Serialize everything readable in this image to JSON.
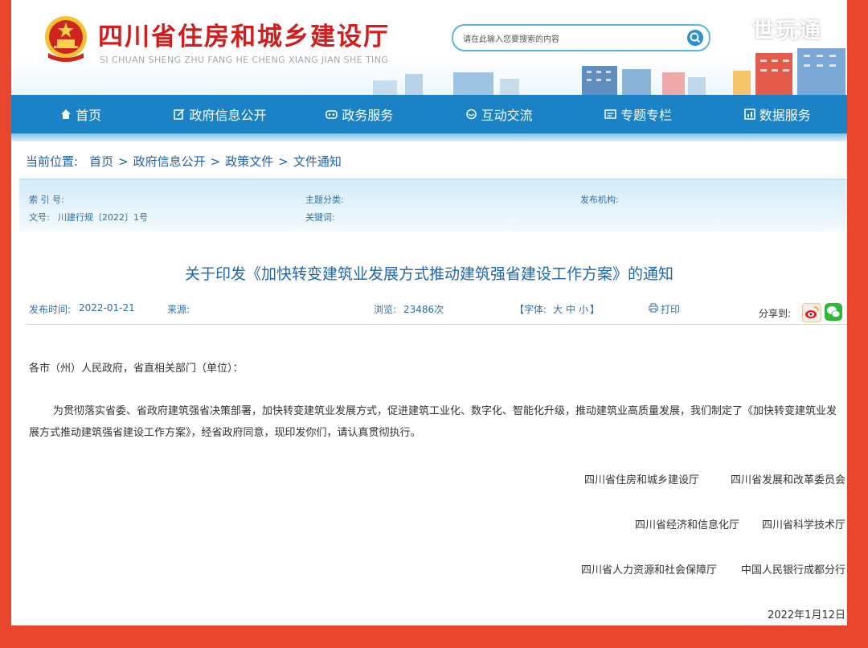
{
  "header": {
    "title": "四川省住房和城乡建设厅",
    "subtitle": "SI CHUAN SHENG ZHU FANG HE CHENG XIANG JIAN SHE TING",
    "search_placeholder": "请在此输入您要搜索的内容",
    "watermark": "世玩通"
  },
  "nav": {
    "items": [
      {
        "label": "首页",
        "icon": "home-icon"
      },
      {
        "label": "政府信息公开",
        "icon": "edit-icon"
      },
      {
        "label": "政务服务",
        "icon": "service-icon"
      },
      {
        "label": "互动交流",
        "icon": "chat-icon"
      },
      {
        "label": "专题专栏",
        "icon": "topic-icon"
      },
      {
        "label": "数据服务",
        "icon": "data-icon"
      }
    ]
  },
  "breadcrumb": {
    "prefix": "当前位置:",
    "items": [
      "首页",
      "政府信息公开",
      "政策文件",
      "文件通知"
    ],
    "sep": ">"
  },
  "meta": {
    "index_label": "索 引 号:",
    "topic_label": "主题分类:",
    "issuer_label": "发布机构:",
    "docno_label": "文号:",
    "docno_value": "川建行规〔2022〕1号",
    "keywords_label": "关键词:"
  },
  "document": {
    "title": "关于印发《加快转变建筑业发展方式推动建筑强省建设工作方案》的通知",
    "publish_label": "发布时间:",
    "publish_date": "2022-01-21",
    "source_label": "来源:",
    "views_label": "浏览:",
    "views_value": "23486次",
    "font_label": "【字体:",
    "font_large": "大",
    "font_medium": "中",
    "font_small": "小",
    "font_close": "】",
    "print_label": "打印",
    "share_label": "分享到:",
    "salutation": "各市（州）人民政府，省直相关部门（单位）：",
    "paragraph": "为贯彻落实省委、省政府建筑强省决策部署，加快转变建筑业发展方式，促进建筑工业化、数字化、智能化升级，推动建筑业高质量发展，我们制定了《加快转变建筑业发展方式推动建筑强省建设工作方案》，经省政府同意，现印发你们，请认真贯彻执行。",
    "signatories": [
      [
        "四川省住房和城乡建设厅",
        "四川省发展和改革委员会"
      ],
      [
        "四川省经济和信息化厅",
        "四川省科学技术厅"
      ],
      [
        "四川省人力资源和社会保障厅",
        "中国人民银行成都分行"
      ]
    ],
    "sign_date": "2022年1月12日"
  },
  "colors": {
    "frame": "#e8462d",
    "nav": "#1b82c5",
    "title_red": "#d11d1d",
    "link_blue": "#2660a8"
  }
}
